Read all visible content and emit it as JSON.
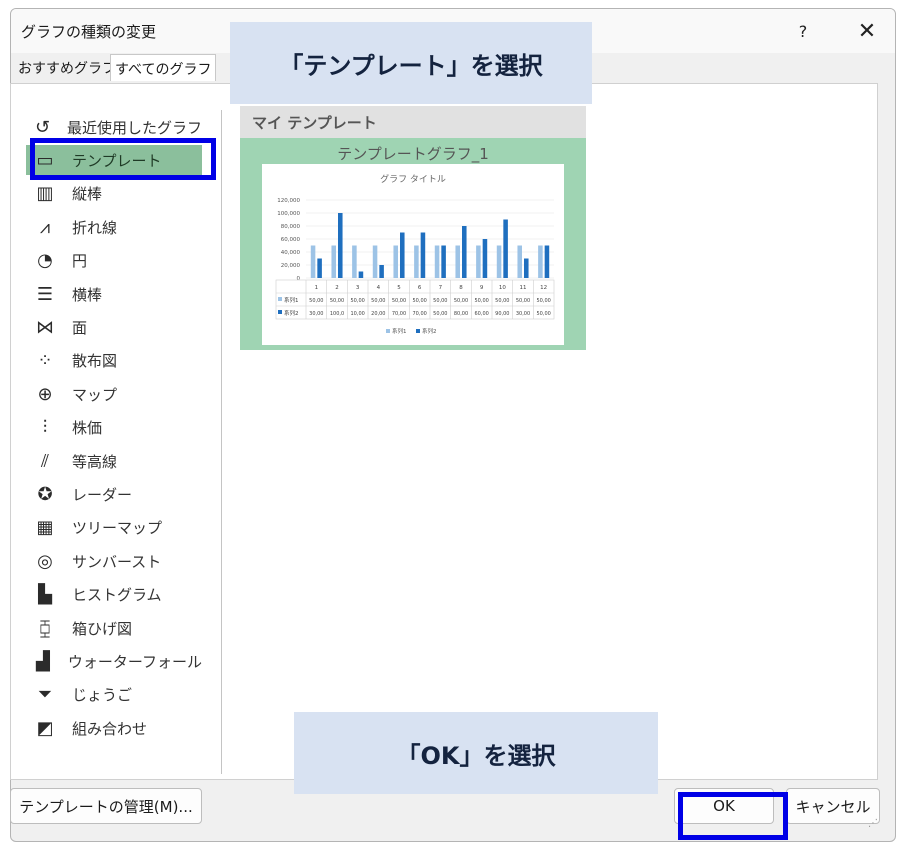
{
  "dialog": {
    "title": "グラフの種類の変更",
    "help_label": "?",
    "close_label": "✕"
  },
  "tabs": [
    {
      "label": "おすすめグラフ"
    },
    {
      "label": "すべてのグラフ"
    }
  ],
  "chart_types": [
    {
      "label": "最近使用したグラフ",
      "icon": "recent-icon"
    },
    {
      "label": "テンプレート",
      "icon": "folder-icon",
      "selected": true
    },
    {
      "label": "縦棒",
      "icon": "column-chart-icon"
    },
    {
      "label": "折れ線",
      "icon": "line-chart-icon"
    },
    {
      "label": "円",
      "icon": "pie-chart-icon"
    },
    {
      "label": "横棒",
      "icon": "bar-chart-icon"
    },
    {
      "label": "面",
      "icon": "area-chart-icon"
    },
    {
      "label": "散布図",
      "icon": "scatter-chart-icon"
    },
    {
      "label": "マップ",
      "icon": "map-chart-icon"
    },
    {
      "label": "株価",
      "icon": "stock-chart-icon"
    },
    {
      "label": "等高線",
      "icon": "surface-chart-icon"
    },
    {
      "label": "レーダー",
      "icon": "radar-chart-icon"
    },
    {
      "label": "ツリーマップ",
      "icon": "treemap-chart-icon"
    },
    {
      "label": "サンバースト",
      "icon": "sunburst-chart-icon"
    },
    {
      "label": "ヒストグラム",
      "icon": "histogram-chart-icon"
    },
    {
      "label": "箱ひげ図",
      "icon": "boxplot-chart-icon"
    },
    {
      "label": "ウォーターフォール",
      "icon": "waterfall-chart-icon"
    },
    {
      "label": "じょうご",
      "icon": "funnel-chart-icon"
    },
    {
      "label": "組み合わせ",
      "icon": "combo-chart-icon"
    }
  ],
  "preview": {
    "section_title": "マイ テンプレート",
    "template_name": "テンプレートグラフ_1"
  },
  "buttons": {
    "manage": "テンプレートの管理(M)...",
    "ok": "OK",
    "cancel": "キャンセル"
  },
  "callouts": {
    "template": "「テンプレート」を選択",
    "ok": "「OK」を選択"
  },
  "colors": {
    "series1": "#9dc3e6",
    "series2": "#1f6fbf",
    "selected_bg": "#8bbf9c",
    "tile_bg": "#9fd4b3",
    "callout_bg": "#d8e2f2",
    "highlight": "#0000e6"
  },
  "chart_data": {
    "type": "bar",
    "title": "グラフ タイトル",
    "categories": [
      "1",
      "2",
      "3",
      "4",
      "5",
      "6",
      "7",
      "8",
      "9",
      "10",
      "11",
      "12"
    ],
    "series": [
      {
        "name": "系列1",
        "values": [
          50000,
          50000,
          50000,
          50000,
          50000,
          50000,
          50000,
          50000,
          50000,
          50000,
          50000,
          50000
        ]
      },
      {
        "name": "系列2",
        "values": [
          30000,
          100000,
          10000,
          20000,
          70000,
          70000,
          50000,
          80000,
          60000,
          90000,
          30000,
          50000
        ]
      }
    ],
    "table_cells": [
      [
        "50,00",
        "50,00",
        "50,00",
        "50,00",
        "50,00",
        "50,00",
        "50,00",
        "50,00",
        "50,00",
        "50,00",
        "50,00",
        "50,00"
      ],
      [
        "30,00",
        "100,0",
        "10,00",
        "20,00",
        "70,00",
        "70,00",
        "50,00",
        "80,00",
        "60,00",
        "90,00",
        "30,00",
        "50,00"
      ]
    ],
    "yticks": [
      "0",
      "20,000",
      "40,000",
      "60,000",
      "80,000",
      "100,000",
      "120,000"
    ],
    "ylim": [
      0,
      120000
    ],
    "grid": true,
    "legend": "bottom"
  }
}
